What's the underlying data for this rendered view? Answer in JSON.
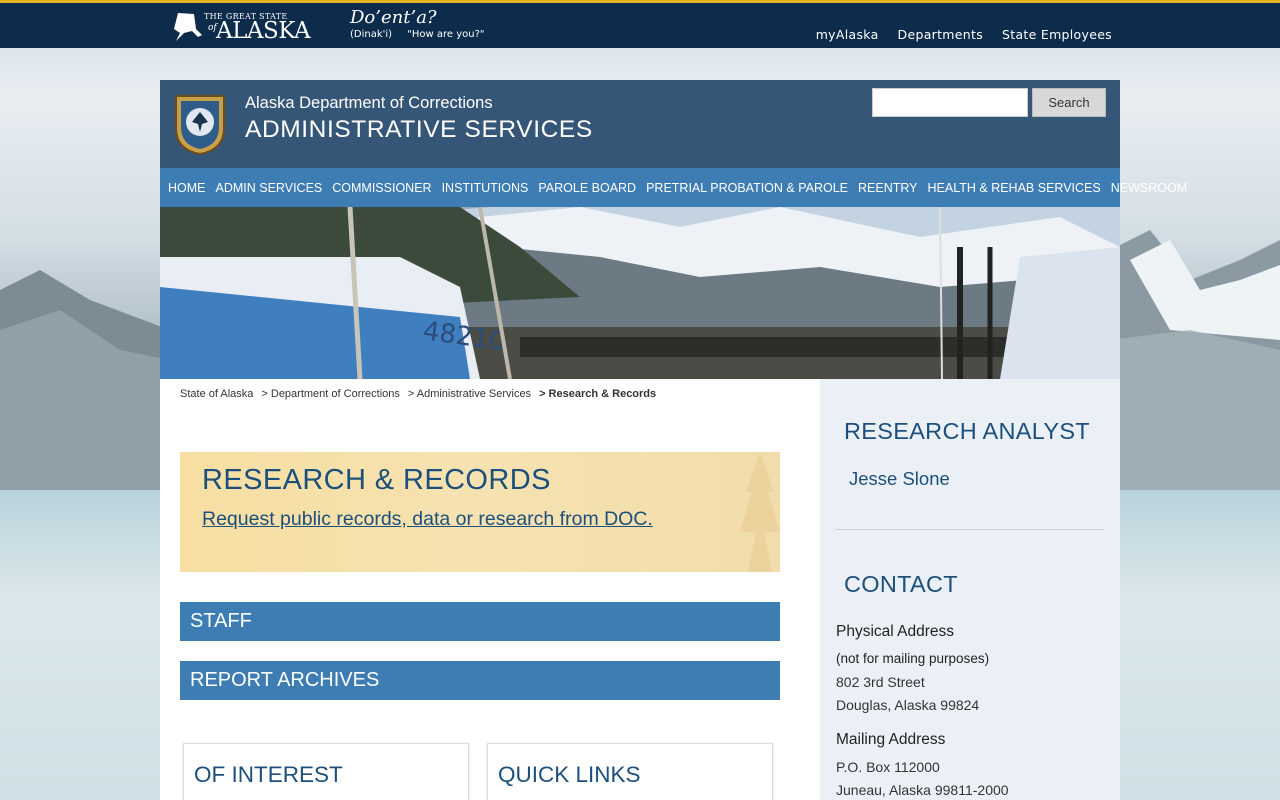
{
  "topbar": {
    "logo_small": "THE GREAT STATE",
    "logo_of": "of",
    "logo_big": "ALASKA",
    "greeting": "Do’ent’a?",
    "greeting_language": "(Dinak'i)",
    "greeting_translation": "\"How are you?\"",
    "links": [
      "myAlaska",
      "Departments",
      "State Employees"
    ]
  },
  "header": {
    "org_name": "Alaska Department of Corrections",
    "org_sub": "ADMINISTRATIVE SERVICES",
    "search_placeholder": "",
    "search_button": "Search"
  },
  "nav": [
    "HOME",
    "ADMIN SERVICES",
    "COMMISSIONER",
    "INSTITUTIONS",
    "PAROLE BOARD",
    "PRETRIAL PROBATION & PAROLE",
    "REENTRY",
    "HEALTH & REHAB SERVICES",
    "NEWSROOM"
  ],
  "breadcrumb": [
    "State of Alaska",
    "> Department of Corrections",
    "> Administrative Services",
    "> Research & Records"
  ],
  "main": {
    "title": "RESEARCH & RECORDS",
    "link": "Request public records, data or research from DOC.",
    "accordions": [
      "STAFF",
      "REPORT ARCHIVES"
    ],
    "cards": [
      "OF INTEREST",
      "QUICK LINKS"
    ]
  },
  "sidebar": {
    "analyst_heading": "RESEARCH ANALYST",
    "analyst_name": "Jesse Slone",
    "contact_heading": "CONTACT",
    "physical_label": "Physical Address",
    "physical_note": "(not for mailing purposes)",
    "physical_lines": [
      "802 3rd Street",
      "Douglas, Alaska 99824"
    ],
    "mailing_label": "Mailing Address",
    "mailing_lines": [
      "P.O. Box 112000",
      "Juneau, Alaska 99811-2000"
    ]
  },
  "colors": {
    "topbar": "#0d2b4a",
    "accent_gold": "#e2b325",
    "header": "#355677",
    "nav": "#3d7db3",
    "heading_blue": "#1c4f7c"
  }
}
